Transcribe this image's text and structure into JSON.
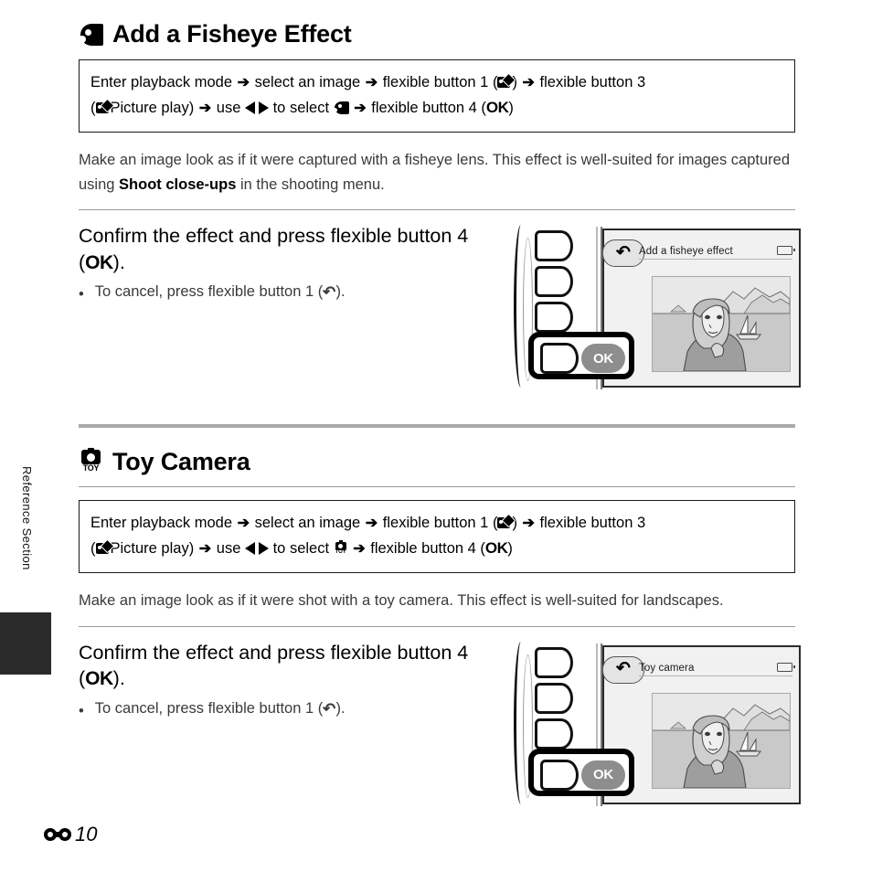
{
  "page": {
    "side_tab_label": "Reference Section",
    "page_marker_symbol": "E",
    "page_number": "10"
  },
  "sections": [
    {
      "icon": "fisheye-fish-icon",
      "title": "Add a Fisheye Effect",
      "procedure": {
        "line1_a": "Enter playback mode",
        "line1_b": "select an image",
        "line1_c": "flexible button 1 (",
        "line1_d": ")",
        "line1_e": "flexible button 3",
        "line2_a": "(",
        "line2_b": "Picture play)",
        "line2_c": "use",
        "line2_d": "to select",
        "line2_e": "flexible button 4 (",
        "line2_ok": "OK",
        "line2_f": ")",
        "arrow": "➔"
      },
      "description_pre": "Make an image look as if it were captured with a fisheye lens. This effect is well-suited for images captured using ",
      "description_bold": "Shoot close-ups",
      "description_post": " in the shooting menu.",
      "step": {
        "head_a": "Confirm the effect and press flexible button 4 (",
        "head_ok": "OK",
        "head_b": ").",
        "bullet_dot": "•",
        "bullet_a": "To cancel, press flexible button 1 (",
        "bullet_arrow": "↷",
        "bullet_b": ")."
      },
      "camera": {
        "screen_title": "Add a fisheye effect",
        "ok_label": "OK",
        "back_arrow": "↷"
      }
    },
    {
      "icon": "toy-camera-icon",
      "icon_word": "TOY",
      "title": "Toy Camera",
      "procedure": {
        "line1_a": "Enter playback mode",
        "line1_b": "select an image",
        "line1_c": "flexible button 1 (",
        "line1_d": ")",
        "line1_e": "flexible button 3",
        "line2_a": "(",
        "line2_b": "Picture play)",
        "line2_c": "use",
        "line2_d": "to select",
        "line2_e": "flexible button 4 (",
        "line2_ok": "OK",
        "line2_f": ")",
        "arrow": "➔"
      },
      "description_pre": "Make an image look as if it were shot with a toy camera. This effect is well-suited for landscapes.",
      "description_bold": "",
      "description_post": "",
      "step": {
        "head_a": "Confirm the effect and press flexible button 4 (",
        "head_ok": "OK",
        "head_b": ").",
        "bullet_dot": "•",
        "bullet_a": "To cancel, press flexible button 1 (",
        "bullet_arrow": "↷",
        "bullet_b": ")."
      },
      "camera": {
        "screen_title": "Toy camera",
        "ok_label": "OK",
        "back_arrow": "↷"
      }
    }
  ],
  "colors": {
    "rule": "#9a9a9a",
    "divider": "#a9a9a9",
    "screen_bg": "#f1f1f1",
    "ok_pill": "#8d8d8d",
    "tab_block": "#2b2b2b"
  }
}
